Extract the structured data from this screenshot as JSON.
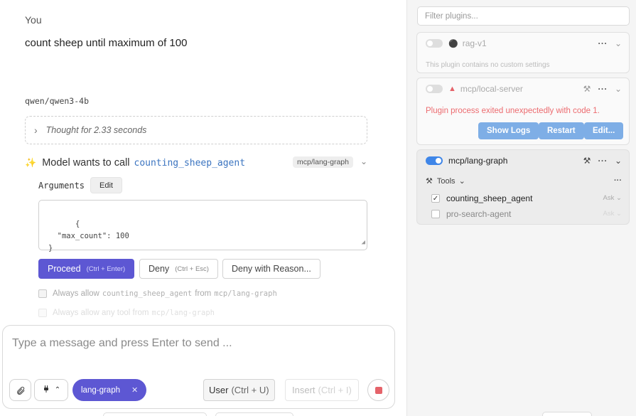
{
  "chat": {
    "sender": "You",
    "message": "count sheep until maximum of 100",
    "model": "qwen/qwen3-4b",
    "thought": "Thought for 2.33 seconds",
    "tool_call": {
      "prefix": "Model wants to call",
      "function": "counting_sheep_agent",
      "badge": "mcp/lang-graph",
      "arguments_label": "Arguments",
      "edit_label": "Edit",
      "arguments": "{\n  \"max_count\": 100\n}",
      "proceed_label": "Proceed",
      "proceed_shortcut": "(Ctrl + Enter)",
      "deny_label": "Deny",
      "deny_shortcut": "(Ctrl + Esc)",
      "reason_label": "Deny with Reason...",
      "allow1": {
        "pre": "Always allow",
        "fn": "counting_sheep_agent",
        "mid": "from",
        "src": "mcp/lang-graph"
      },
      "allow2": {
        "pre": "Always allow any tool from",
        "src": "mcp/lang-graph"
      }
    }
  },
  "composer": {
    "placeholder": "Type a message and press Enter to send ...",
    "chip": "lang-graph",
    "user_label": "User",
    "user_shortcut": "(Ctrl + U)",
    "insert_label": "Insert",
    "insert_shortcut": "(Ctrl + I)"
  },
  "panel": {
    "filter_placeholder": "Filter plugins...",
    "plugins": [
      {
        "name": "rag-v1",
        "enabled": false,
        "note": "This plugin contains no custom settings"
      },
      {
        "name": "mcp/local-server",
        "enabled": false,
        "error": "Plugin process exited unexpectedly with code 1.",
        "buttons": [
          "Show Logs",
          "Restart",
          "Edit..."
        ]
      },
      {
        "name": "mcp/lang-graph",
        "enabled": true,
        "tools_label": "Tools",
        "tools": [
          {
            "name": "counting_sheep_agent",
            "checked": true,
            "mode": "Ask"
          },
          {
            "name": "pro-search-agent",
            "checked": false,
            "mode": "Ask"
          }
        ]
      }
    ]
  },
  "colors": {
    "accent": "#5d57d3",
    "toggle_on": "#3f86e8",
    "error": "#ec6b6f",
    "button_blue": "#7eaee6"
  }
}
